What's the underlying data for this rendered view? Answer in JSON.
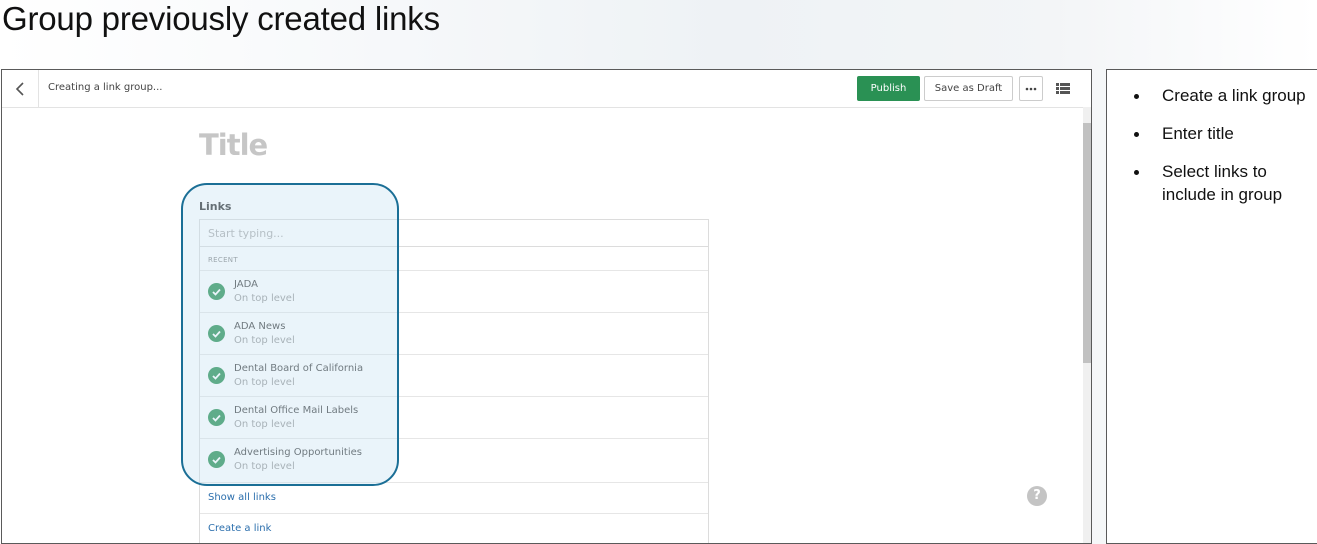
{
  "slide_title": "Group previously created links",
  "editor": {
    "breadcrumb": "Creating a link group...",
    "publish_label": "Publish",
    "draft_label": "Save as Draft",
    "title_placeholder": "Title",
    "links_label": "Links",
    "search_placeholder": "Start typing...",
    "recent_heading": "RECENT",
    "recent_items": [
      {
        "name": "JADA",
        "location": "On top level"
      },
      {
        "name": "ADA News",
        "location": "On top level"
      },
      {
        "name": "Dental Board of California",
        "location": "On top level"
      },
      {
        "name": "Dental Office Mail Labels",
        "location": "On top level"
      },
      {
        "name": "Advertising Opportunities",
        "location": "On top level"
      }
    ],
    "show_all_label": "Show all links",
    "create_link_label": "Create a link",
    "help_glyph": "?"
  },
  "notes": {
    "bullets": [
      "Create a link group",
      "Enter title",
      "Select links to\ninclude in group"
    ]
  },
  "colors": {
    "publish_green": "#2a9154",
    "highlight_border": "#1b6f96",
    "link_blue": "#2c6fad"
  }
}
